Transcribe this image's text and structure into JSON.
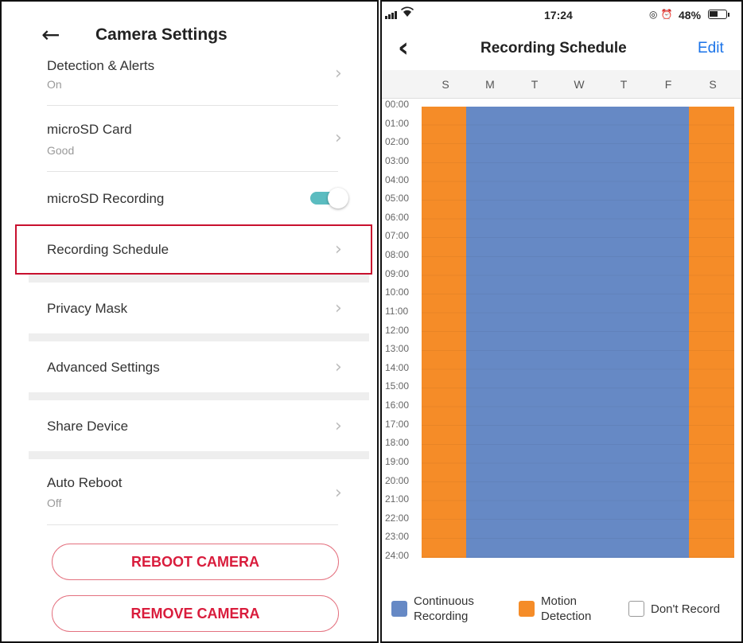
{
  "left": {
    "title": "Camera Settings",
    "rows": [
      {
        "label": "Detection & Alerts",
        "sub": "On"
      },
      {
        "label": "microSD Card",
        "sub": "Good"
      },
      {
        "label": "microSD Recording",
        "toggle_on": true
      },
      {
        "label": "Recording Schedule"
      },
      {
        "label": "Privacy Mask"
      },
      {
        "label": "Advanced Settings"
      },
      {
        "label": "Share Device"
      },
      {
        "label": "Auto Reboot",
        "sub": "Off"
      }
    ],
    "buttons": {
      "reboot": "REBOOT CAMERA",
      "remove": "REMOVE CAMERA"
    },
    "colors": {
      "toggle_on": "#5bbcc0",
      "button_text": "#d91c3c",
      "highlight": "#c8102e"
    }
  },
  "right": {
    "status": {
      "time": "17:24",
      "battery": "48%",
      "battery_level": 0.48
    },
    "title": "Recording Schedule",
    "edit": "Edit",
    "days": [
      "S",
      "M",
      "T",
      "W",
      "T",
      "F",
      "S"
    ],
    "hours": [
      "00:00",
      "01:00",
      "02:00",
      "03:00",
      "04:00",
      "05:00",
      "06:00",
      "07:00",
      "08:00",
      "09:00",
      "10:00",
      "11:00",
      "12:00",
      "13:00",
      "14:00",
      "15:00",
      "16:00",
      "17:00",
      "18:00",
      "19:00",
      "20:00",
      "21:00",
      "22:00",
      "23:00",
      "24:00"
    ],
    "schedule": [
      "motion",
      "continuous",
      "continuous",
      "continuous",
      "continuous",
      "continuous",
      "motion"
    ],
    "legend": {
      "continuous": "Continuous Recording",
      "motion": "Motion Detection",
      "none": "Don't Record"
    },
    "colors": {
      "continuous": "#6689c5",
      "motion": "#f58c28",
      "edit": "#1a73e8"
    }
  }
}
